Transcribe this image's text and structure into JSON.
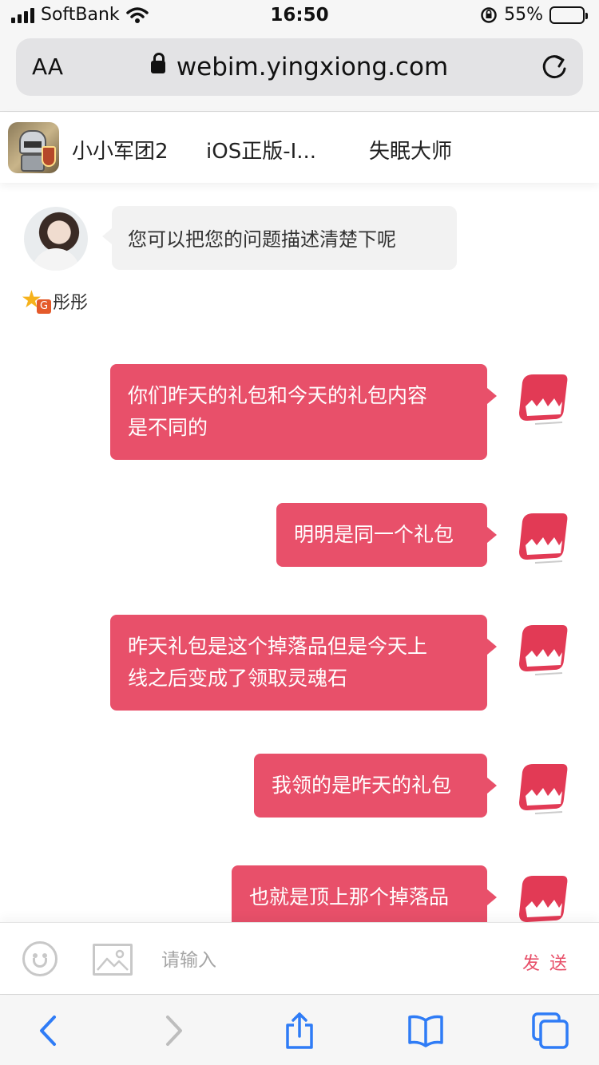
{
  "status_bar": {
    "carrier": "SoftBank",
    "time": "16:50",
    "battery_percent": "55%",
    "battery_level": 0.55,
    "icons": [
      "signal-icon",
      "wifi-icon",
      "orientation-lock-icon",
      "battery-icon"
    ]
  },
  "browser": {
    "text_size_label": "AA",
    "url": "webim.yingxiong.com",
    "icons": [
      "lock-icon",
      "reload-icon"
    ]
  },
  "header": {
    "tabs": [
      {
        "label": "小小军团2"
      },
      {
        "label": "iOS正版-I..."
      },
      {
        "label": "失眠大师"
      }
    ]
  },
  "chat": {
    "agent_message": "您可以把您的问题描述清楚下呢",
    "agent_name": "彤彤",
    "badge_letter": "G",
    "outgoing_messages": [
      {
        "line1": "你们昨天的礼包和今天的礼包内容",
        "line2": "是不同的"
      },
      {
        "line1": "明明是同一个礼包"
      },
      {
        "line1": "昨天礼包是这个掉落品但是今天上",
        "line2": "线之后变成了领取灵魂石"
      },
      {
        "line1": "我领的是昨天的礼包"
      },
      {
        "line1": "也就是顶上那个掉落品"
      }
    ],
    "colors": {
      "outgoing_bubble": "#e8506a",
      "incoming_bubble": "#f2f2f2"
    }
  },
  "composer": {
    "placeholder": "请输入",
    "send_label": "发送",
    "icons": [
      "emoji-icon",
      "image-icon"
    ]
  },
  "toolbar": {
    "icons": [
      "back-icon",
      "forward-icon",
      "share-icon",
      "bookmarks-icon",
      "tabs-icon"
    ]
  }
}
